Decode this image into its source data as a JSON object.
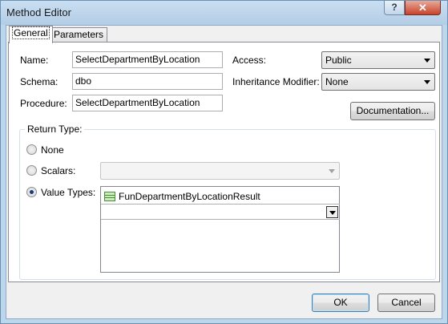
{
  "window": {
    "title": "Method Editor",
    "help_label": "?",
    "close_label": "✕"
  },
  "tabs": [
    {
      "label": "General",
      "active": true
    },
    {
      "label": "Parameters",
      "active": false
    }
  ],
  "form": {
    "name_label": "Name:",
    "name_value": "SelectDepartmentByLocation",
    "schema_label": "Schema:",
    "schema_value": "dbo",
    "procedure_label": "Procedure:",
    "procedure_value": "SelectDepartmentByLocation",
    "access_label": "Access:",
    "access_value": "Public",
    "inheritance_label": "Inheritance Modifier:",
    "inheritance_value": "None",
    "documentation_label": "Documentation..."
  },
  "return_type": {
    "group_label": "Return Type:",
    "none_label": "None",
    "scalars_label": "Scalars:",
    "scalars_value": "",
    "value_types_label": "Value Types:",
    "selected": "Value Types",
    "value_types_items": [
      "FunDepartmentByLocationResult"
    ]
  },
  "footer": {
    "ok_label": "OK",
    "cancel_label": "Cancel"
  }
}
